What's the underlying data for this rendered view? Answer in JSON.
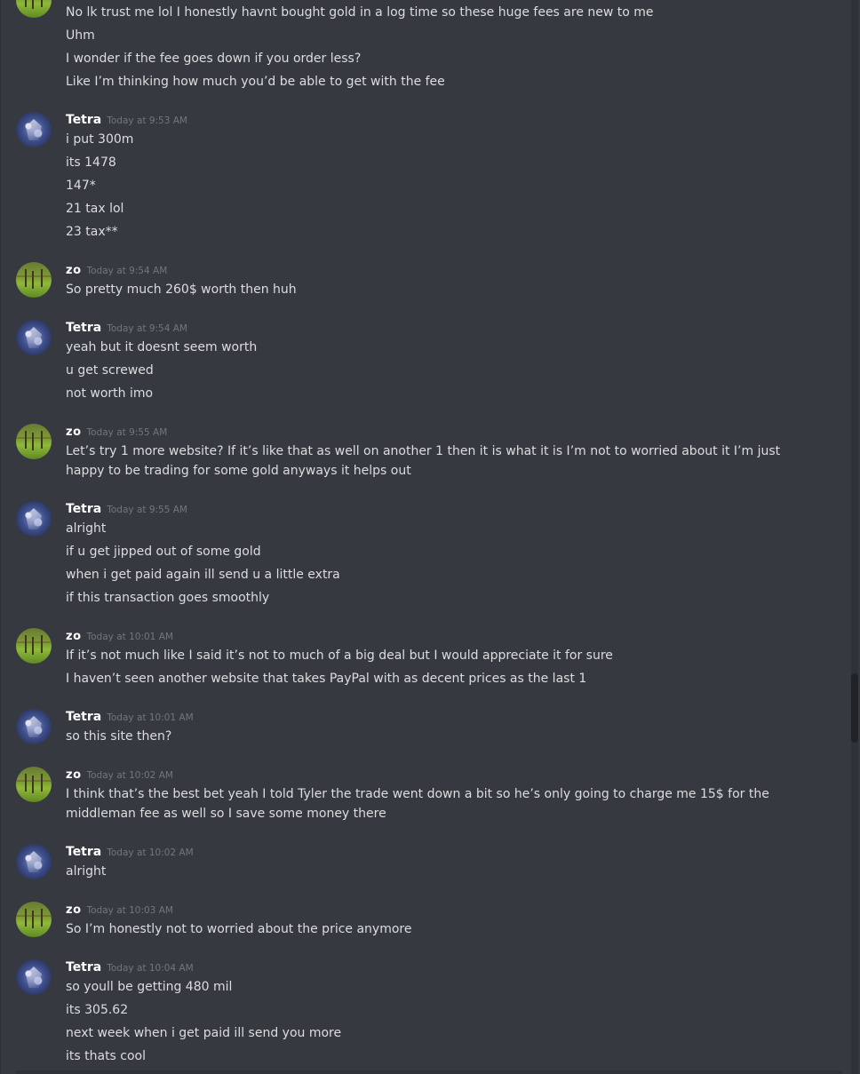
{
  "groups": [
    {
      "username": "",
      "timestamp": "",
      "avatar": "zo",
      "lines": [
        "No lk trust me lol I honestly havnt bought gold in a log time so these huge fees are new to me",
        "Uhm",
        "I wonder if the fee goes down if you order less?",
        "Like I’m thinking how much you’d be able to get with the fee"
      ]
    },
    {
      "username": "Tetra",
      "timestamp": "Today at 9:53 AM",
      "avatar": "tetra",
      "lines": [
        "i put 300m",
        "its 1478",
        "147*",
        "21 tax lol",
        "23 tax**"
      ]
    },
    {
      "username": "zo",
      "timestamp": "Today at 9:54 AM",
      "avatar": "zo",
      "lines": [
        "So pretty much 260$ worth then huh"
      ]
    },
    {
      "username": "Tetra",
      "timestamp": "Today at 9:54 AM",
      "avatar": "tetra",
      "lines": [
        "yeah but it doesnt seem worth",
        "u get screwed",
        "not worth imo"
      ]
    },
    {
      "username": "zo",
      "timestamp": "Today at 9:55 AM",
      "avatar": "zo",
      "lines": [
        "Let’s try 1 more website? If it’s like that as well on another 1 then it is what it is I’m not to worried about it I’m just happy to be trading for some gold anyways it helps out"
      ]
    },
    {
      "username": "Tetra",
      "timestamp": "Today at 9:55 AM",
      "avatar": "tetra",
      "lines": [
        "alright",
        "if u get jipped out of some gold",
        "when i get paid again ill send u a little extra",
        "if this transaction goes smoothly"
      ]
    },
    {
      "username": "zo",
      "timestamp": "Today at 10:01 AM",
      "avatar": "zo",
      "lines": [
        "If it’s not much like I said it’s not to much of a big deal but I would appreciate it for sure",
        "I haven’t seen another website that takes PayPal with as decent prices as the last 1"
      ]
    },
    {
      "username": "Tetra",
      "timestamp": "Today at 10:01 AM",
      "avatar": "tetra",
      "lines": [
        "so this site then?"
      ]
    },
    {
      "username": "zo",
      "timestamp": "Today at 10:02 AM",
      "avatar": "zo",
      "lines": [
        "I think that’s the best bet yeah I told Tyler the trade went down a bit so he’s only going to charge me 15$ for the middleman fee as well so I save some money there"
      ]
    },
    {
      "username": "Tetra",
      "timestamp": "Today at 10:02 AM",
      "avatar": "tetra",
      "lines": [
        "alright"
      ]
    },
    {
      "username": "zo",
      "timestamp": "Today at 10:03 AM",
      "avatar": "zo",
      "lines": [
        "So I’m honestly not to worried about the price anymore"
      ]
    },
    {
      "username": "Tetra",
      "timestamp": "Today at 10:04 AM",
      "avatar": "tetra",
      "lines": [
        "so youll be getting 480 mil",
        "its 305.62",
        "next week when i get paid ill send you more",
        "its thats cool"
      ]
    }
  ]
}
